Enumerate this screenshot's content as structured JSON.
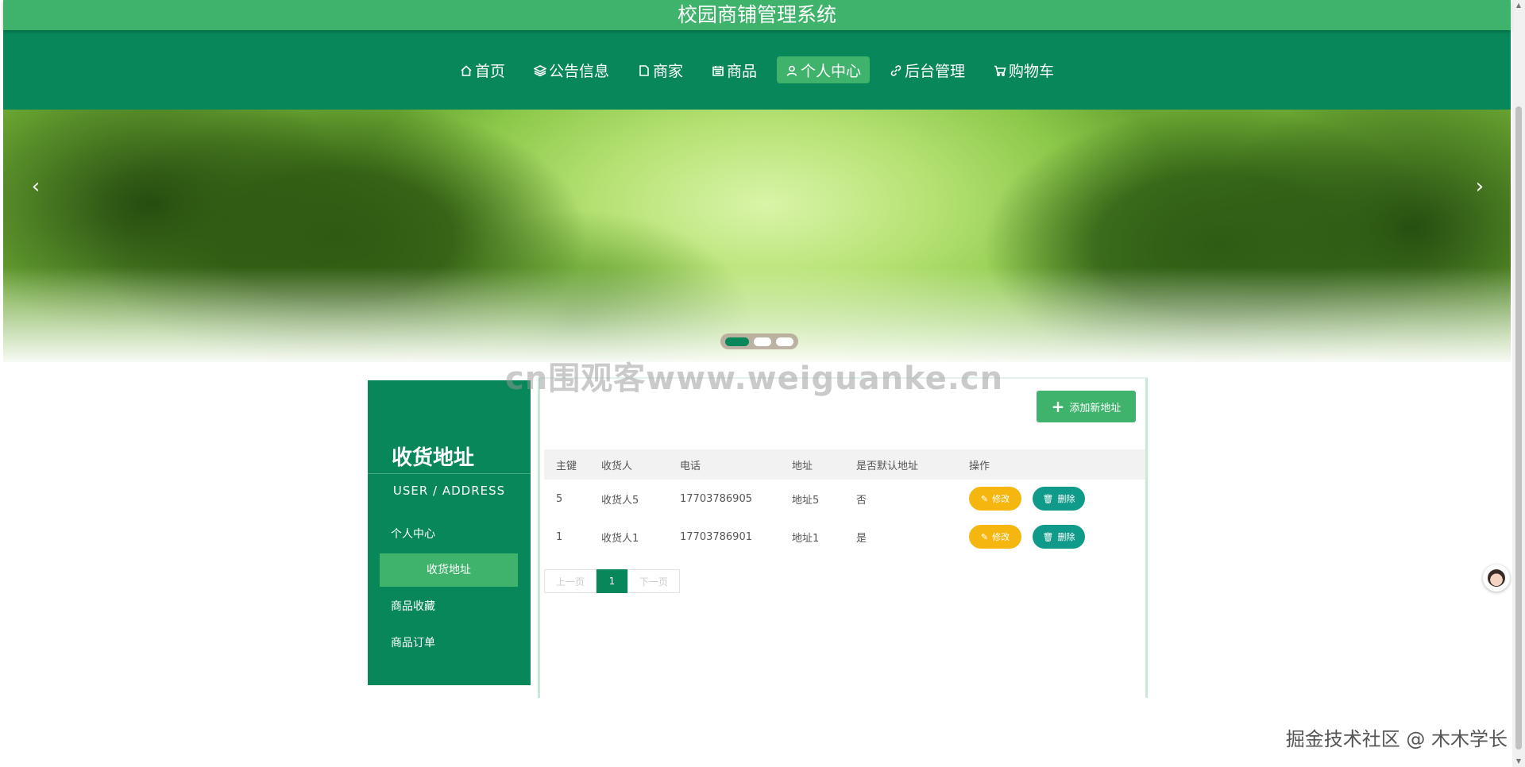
{
  "header": {
    "title": "校园商铺管理系统"
  },
  "nav": {
    "items": [
      {
        "label": "首页",
        "icon": "home-icon"
      },
      {
        "label": "公告信息",
        "icon": "layers-icon"
      },
      {
        "label": "商家",
        "icon": "page-icon"
      },
      {
        "label": "商品",
        "icon": "calendar-icon"
      },
      {
        "label": "个人中心",
        "icon": "user-icon",
        "active": true
      },
      {
        "label": "后台管理",
        "icon": "link-icon"
      },
      {
        "label": "购物车",
        "icon": "cart-icon"
      }
    ]
  },
  "banner": {
    "prev": "‹",
    "next": "›",
    "slide_count": 3,
    "active_slide": 1
  },
  "watermark": {
    "center": "cn围观客www.weiguanke.cn",
    "bottom": "掘金技术社区 @ 木木学长"
  },
  "sidebar": {
    "title": "收货地址",
    "subtitle": "USER / ADDRESS",
    "items": [
      {
        "label": "个人中心"
      },
      {
        "label": "收货地址",
        "active": true
      },
      {
        "label": "商品收藏"
      },
      {
        "label": "商品订单"
      }
    ]
  },
  "content": {
    "add_button": "添加新地址",
    "table": {
      "headers": [
        "主键",
        "收货人",
        "电话",
        "地址",
        "是否默认地址",
        "操作"
      ],
      "rows": [
        {
          "id": "5",
          "name": "收货人5",
          "phone": "17703786905",
          "address": "地址5",
          "default": "否"
        },
        {
          "id": "1",
          "name": "收货人1",
          "phone": "17703786901",
          "address": "地址1",
          "default": "是"
        }
      ],
      "edit_label": "修改",
      "delete_label": "删除"
    },
    "pagination": {
      "prev": "上一页",
      "current": "1",
      "next": "下一页"
    }
  },
  "colors": {
    "primary": "#08885a",
    "accent": "#3fb36b",
    "edit": "#f6b610",
    "delete": "#0f9a8a"
  }
}
